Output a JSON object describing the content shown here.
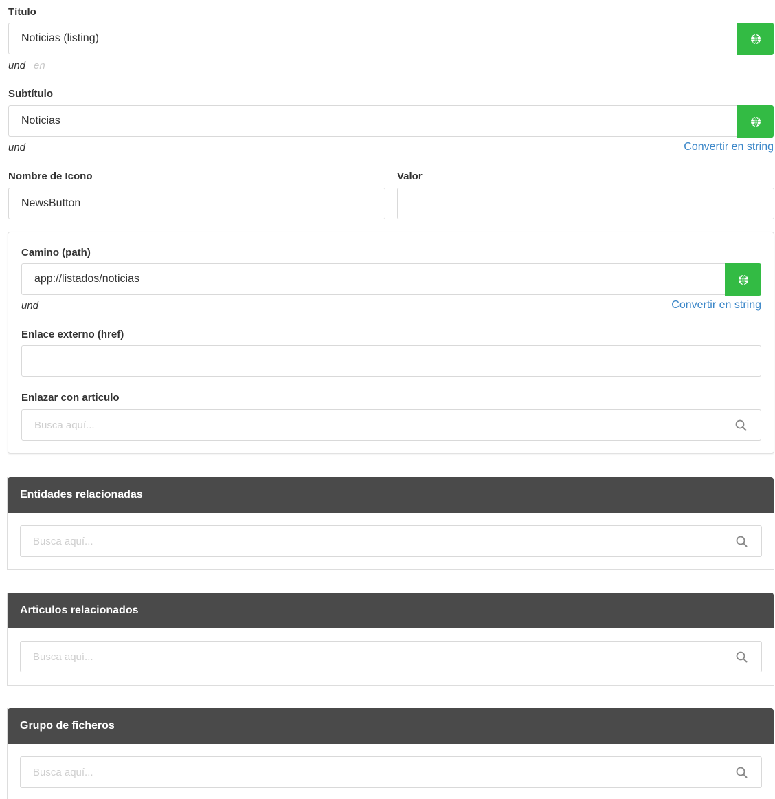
{
  "titulo": {
    "label": "Título",
    "value": "Noticias (listing)",
    "lang_primary": "und",
    "lang_secondary": "en",
    "action_icon": "globe-icon"
  },
  "subtitulo": {
    "label": "Subtítulo",
    "value": "Noticias",
    "lang": "und",
    "convert_link": "Convertir en string",
    "action_icon": "globe-icon"
  },
  "icono": {
    "nombre_label": "Nombre de Icono",
    "nombre_value": "NewsButton",
    "valor_label": "Valor",
    "valor_value": ""
  },
  "link_card": {
    "camino_label": "Camino (path)",
    "camino_value": "app://listados/noticias",
    "camino_lang": "und",
    "convert_link": "Convertir en string",
    "href_label": "Enlace externo (href)",
    "href_value": "",
    "articulo_label": "Enlazar con articulo",
    "articulo_placeholder": "Busca aquí..."
  },
  "panels": [
    {
      "title": "Entidades relacionadas",
      "placeholder": "Busca aquí..."
    },
    {
      "title": "Articulos relacionados",
      "placeholder": "Busca aquí..."
    },
    {
      "title": "Grupo de ficheros",
      "placeholder": "Busca aquí..."
    }
  ],
  "colors": {
    "accent_green": "#33bb44",
    "link_blue": "#3a86c8",
    "panel_header": "#4a4a4a"
  }
}
